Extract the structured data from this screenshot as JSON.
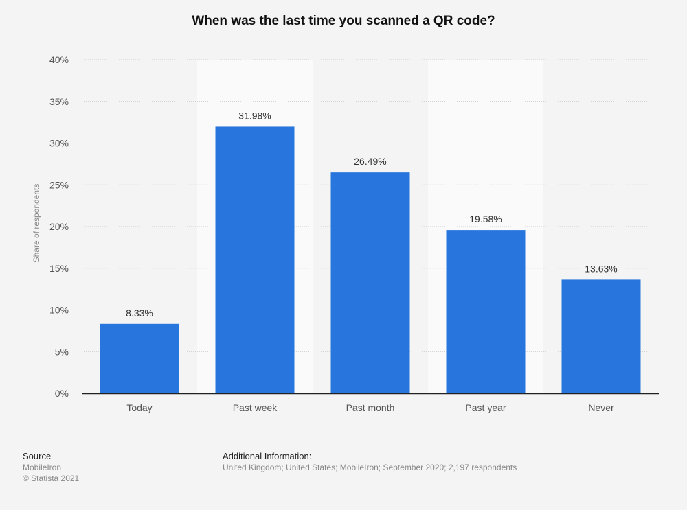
{
  "chart_data": {
    "type": "bar",
    "title": "When was the last time you scanned a QR code?",
    "categories": [
      "Today",
      "Past week",
      "Past month",
      "Past year",
      "Never"
    ],
    "values": [
      8.33,
      31.98,
      26.49,
      19.58,
      13.63
    ],
    "data_labels": [
      "8.33%",
      "31.98%",
      "26.49%",
      "19.58%",
      "13.63%"
    ],
    "xlabel": "",
    "ylabel": "Share of respondents",
    "ylim": [
      0,
      40
    ],
    "yticks": [
      0,
      5,
      10,
      15,
      20,
      25,
      30,
      35,
      40
    ],
    "ytick_labels": [
      "0%",
      "5%",
      "10%",
      "15%",
      "20%",
      "25%",
      "30%",
      "35%",
      "40%"
    ],
    "grid": true,
    "legend": "none",
    "bar_color": "#2876dd"
  },
  "footer": {
    "source_heading": "Source",
    "source_lines": [
      "MobileIron",
      "© Statista 2021"
    ],
    "info_heading": "Additional Information:",
    "info_text": "United Kingdom; United States; MobileIron; September 2020; 2,197 respondents"
  }
}
